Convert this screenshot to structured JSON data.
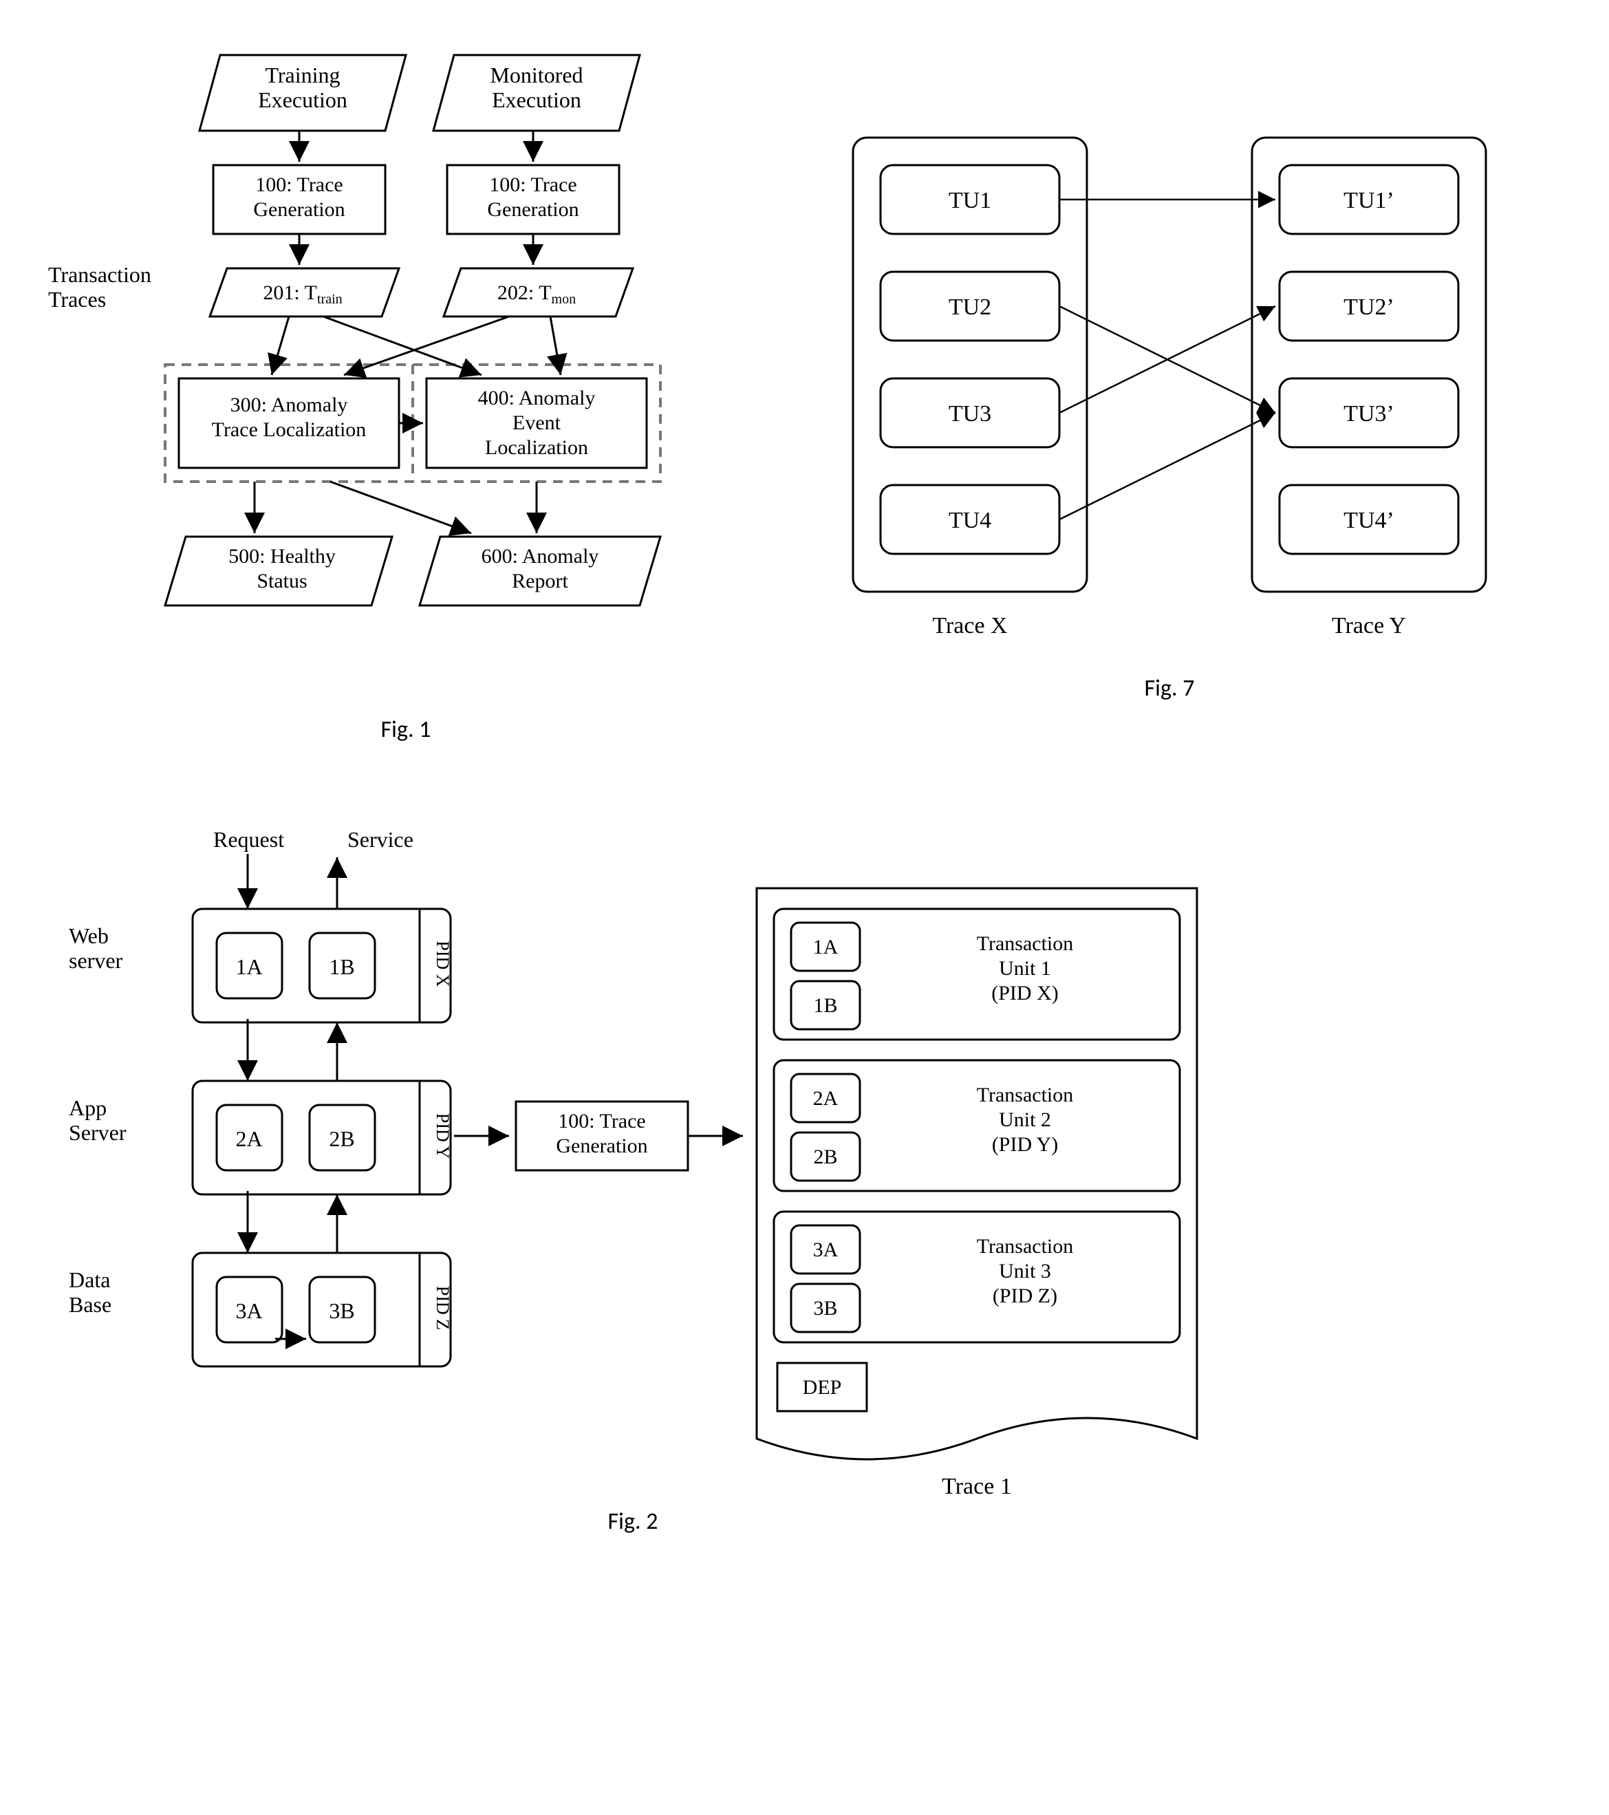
{
  "fig1": {
    "caption": "Fig. 1",
    "training_execution": "Training\nExecution",
    "monitored_execution": "Monitored\nExecution",
    "trace_gen_left": "100: Trace\nGeneration",
    "trace_gen_right": "100: Trace\nGeneration",
    "t_train": "201: Ttrain",
    "t_mon": "202: Tmon",
    "transaction_traces": "Transaction\nTraces",
    "atl": "300: Anomaly\nTrace Localization",
    "ael": "400: Anomaly\nEvent\nLocalization",
    "healthy": "500: Healthy\nStatus",
    "report": "600: Anomaly\nReport"
  },
  "fig7": {
    "caption": "Fig. 7",
    "tracex": "Trace X",
    "tracey": "Trace Y",
    "left": [
      "TU1",
      "TU2",
      "TU3",
      "TU4"
    ],
    "right": [
      "TU1’",
      "TU2’",
      "TU3’",
      "TU4’"
    ],
    "links": [
      [
        0,
        0
      ],
      [
        1,
        2
      ],
      [
        2,
        1
      ],
      [
        3,
        2
      ]
    ]
  },
  "fig2": {
    "caption": "Fig. 2",
    "request": "Request",
    "service": "Service",
    "webserver": "Web\nserver",
    "appserver": "App\nServer",
    "database": "Data\nBase",
    "trace_gen": "100: Trace\nGeneration",
    "pidx": "PID X",
    "pidy": "PID Y",
    "pidz": "PID Z",
    "cells": {
      "1a": "1A",
      "1b": "1B",
      "2a": "2A",
      "2b": "2B",
      "3a": "3A",
      "3b": "3B"
    },
    "tu1_label": "Transaction\nUnit 1\n(PID X)",
    "tu2_label": "Transaction\nUnit 2\n(PID Y)",
    "tu3_label": "Transaction\nUnit 3\n(PID Z)",
    "dep": "DEP",
    "trace1": "Trace 1"
  },
  "chart_data": {
    "type": "diagram",
    "fig1_flow": {
      "nodes": [
        {
          "id": "train_exec",
          "label": "Training Execution",
          "shape": "parallelogram"
        },
        {
          "id": "mon_exec",
          "label": "Monitored Execution",
          "shape": "parallelogram"
        },
        {
          "id": "tg_left",
          "label": "100: Trace Generation",
          "shape": "rect"
        },
        {
          "id": "tg_right",
          "label": "100: Trace Generation",
          "shape": "rect"
        },
        {
          "id": "t_train",
          "label": "201: T_train",
          "shape": "parallelogram"
        },
        {
          "id": "t_mon",
          "label": "202: T_mon",
          "shape": "parallelogram"
        },
        {
          "id": "atl",
          "label": "300: Anomaly Trace Localization",
          "shape": "rect"
        },
        {
          "id": "ael",
          "label": "400: Anomaly Event Localization",
          "shape": "rect"
        },
        {
          "id": "healthy",
          "label": "500: Healthy Status",
          "shape": "parallelogram"
        },
        {
          "id": "report",
          "label": "600: Anomaly Report",
          "shape": "parallelogram"
        }
      ],
      "edges": [
        [
          "train_exec",
          "tg_left"
        ],
        [
          "mon_exec",
          "tg_right"
        ],
        [
          "tg_left",
          "t_train"
        ],
        [
          "tg_right",
          "t_mon"
        ],
        [
          "t_train",
          "atl"
        ],
        [
          "t_train",
          "ael"
        ],
        [
          "t_mon",
          "atl"
        ],
        [
          "t_mon",
          "ael"
        ],
        [
          "atl",
          "ael"
        ],
        [
          "atl",
          "healthy"
        ],
        [
          "atl",
          "report"
        ],
        [
          "ael",
          "report"
        ]
      ],
      "side_label": "Transaction Traces"
    },
    "fig7_mapping": {
      "left_trace": {
        "name": "Trace X",
        "units": [
          "TU1",
          "TU2",
          "TU3",
          "TU4"
        ]
      },
      "right_trace": {
        "name": "Trace Y",
        "units": [
          "TU1'",
          "TU2'",
          "TU3'",
          "TU4'"
        ]
      },
      "mapping_edges": [
        [
          "TU1",
          "TU1'"
        ],
        [
          "TU2",
          "TU3'"
        ],
        [
          "TU3",
          "TU2'"
        ],
        [
          "TU4",
          "TU3'"
        ]
      ]
    },
    "fig2_structure": {
      "tiers": [
        {
          "name": "Web server",
          "pid": "PID X",
          "cells": [
            "1A",
            "1B"
          ]
        },
        {
          "name": "App Server",
          "pid": "PID Y",
          "cells": [
            "2A",
            "2B"
          ]
        },
        {
          "name": "Data Base",
          "pid": "PID Z",
          "cells": [
            "3A",
            "3B"
          ]
        }
      ],
      "io": {
        "in": "Request",
        "out": "Service"
      },
      "process": "100: Trace Generation",
      "output_trace": {
        "name": "Trace 1",
        "units": [
          {
            "label": "Transaction Unit 1 (PID X)",
            "cells": [
              "1A",
              "1B"
            ]
          },
          {
            "label": "Transaction Unit 2 (PID Y)",
            "cells": [
              "2A",
              "2B"
            ]
          },
          {
            "label": "Transaction Unit 3 (PID Z)",
            "cells": [
              "3A",
              "3B"
            ]
          }
        ],
        "extra": "DEP"
      }
    }
  }
}
